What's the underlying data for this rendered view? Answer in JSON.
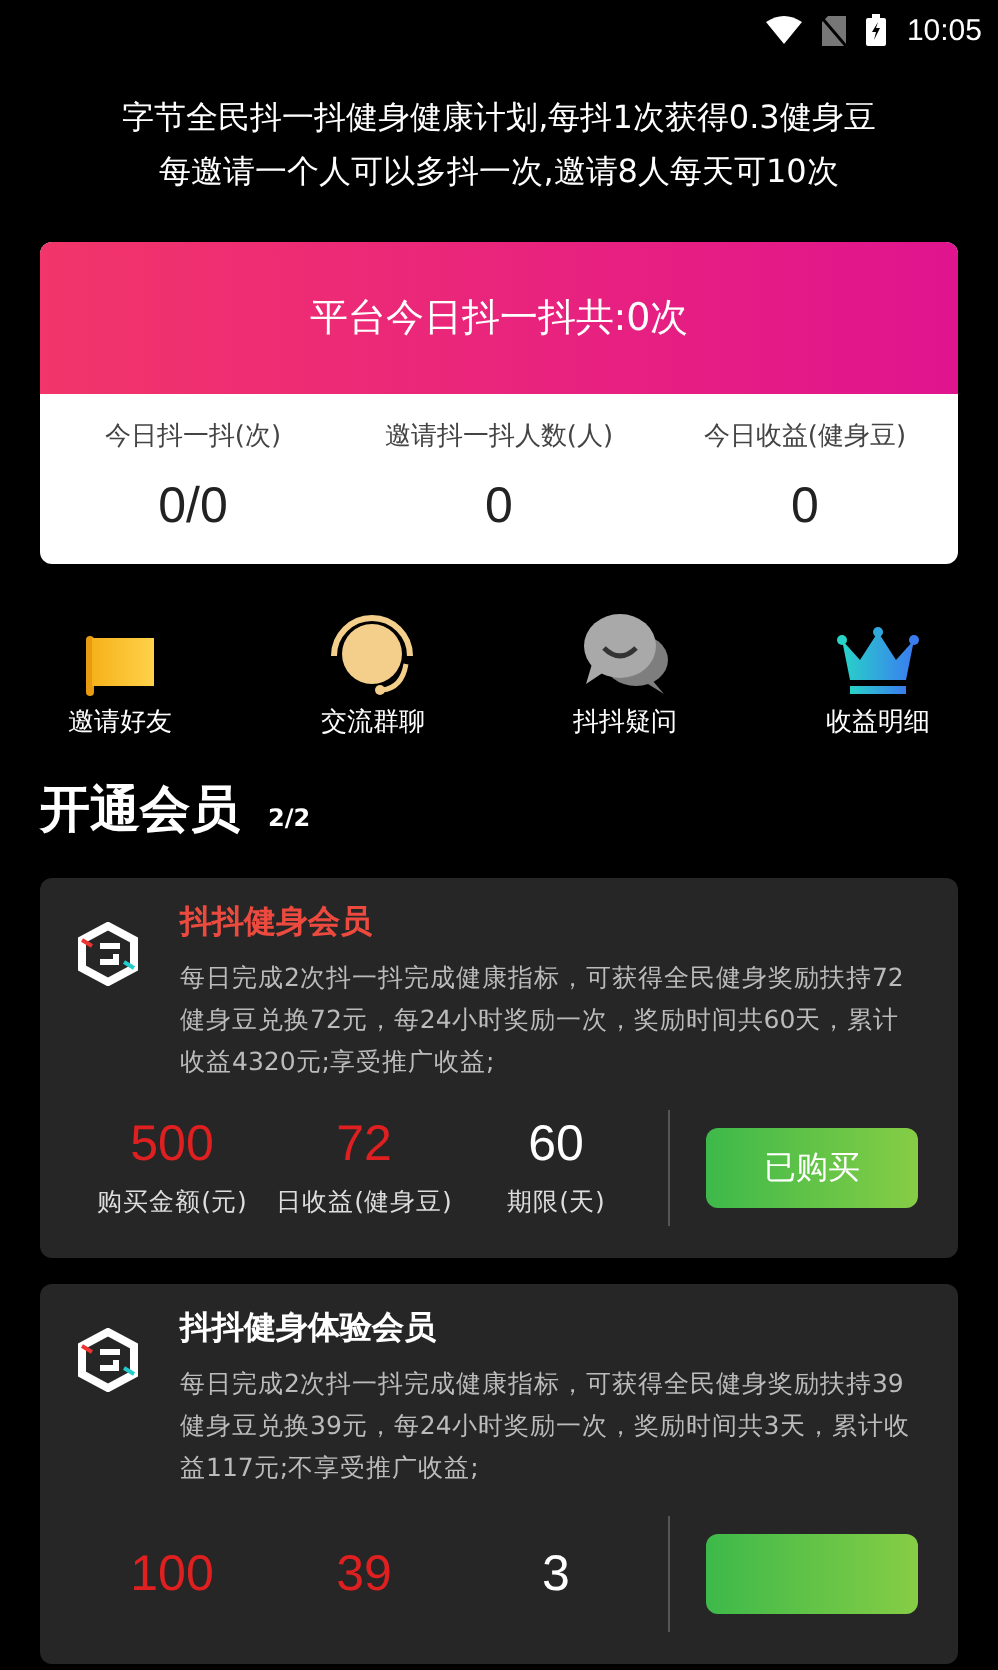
{
  "status_bar": {
    "time": "10:05"
  },
  "intro": [
    "字节全民抖一抖健身健康计划,每抖1次获得0.3健身豆",
    "每邀请一个人可以多抖一次,邀请8人每天可10次"
  ],
  "summary": {
    "title": "平台今日抖一抖共:0次",
    "stats": [
      {
        "label": "今日抖一抖(次)",
        "value": "0/0"
      },
      {
        "label": "邀请抖一抖人数(人)",
        "value": "0"
      },
      {
        "label": "今日收益(健身豆)",
        "value": "0"
      }
    ]
  },
  "shortcuts": [
    {
      "kind": "flag",
      "label": "邀请好友"
    },
    {
      "kind": "headset",
      "label": "交流群聊"
    },
    {
      "kind": "chat",
      "label": "抖抖疑问"
    },
    {
      "kind": "crown",
      "label": "收益明细"
    }
  ],
  "section": {
    "title": "开通会员",
    "count": "2/2"
  },
  "plans": [
    {
      "name": "抖抖健身会员",
      "highlight": true,
      "description": "每日完成2次抖一抖完成健康指标，可获得全民健身奖励扶持72健身豆兑换72元，每24小时奖励一次，奖励时间共60天，累计收益4320元;享受推广收益;",
      "stats": [
        {
          "value": "500",
          "label": "购买金额(元)",
          "red": true
        },
        {
          "value": "72",
          "label": "日收益(健身豆)",
          "red": true
        },
        {
          "value": "60",
          "label": "期限(天)",
          "red": false
        }
      ],
      "button": "已购买"
    },
    {
      "name": "抖抖健身体验会员",
      "highlight": false,
      "description": "每日完成2次抖一抖完成健康指标，可获得全民健身奖励扶持39健身豆兑换39元，每24小时奖励一次，奖励时间共3天，累计收益117元;不享受推广收益;",
      "stats": [
        {
          "value": "100",
          "red": true
        },
        {
          "value": "39",
          "red": true
        },
        {
          "value": "3",
          "red": false
        }
      ]
    }
  ]
}
